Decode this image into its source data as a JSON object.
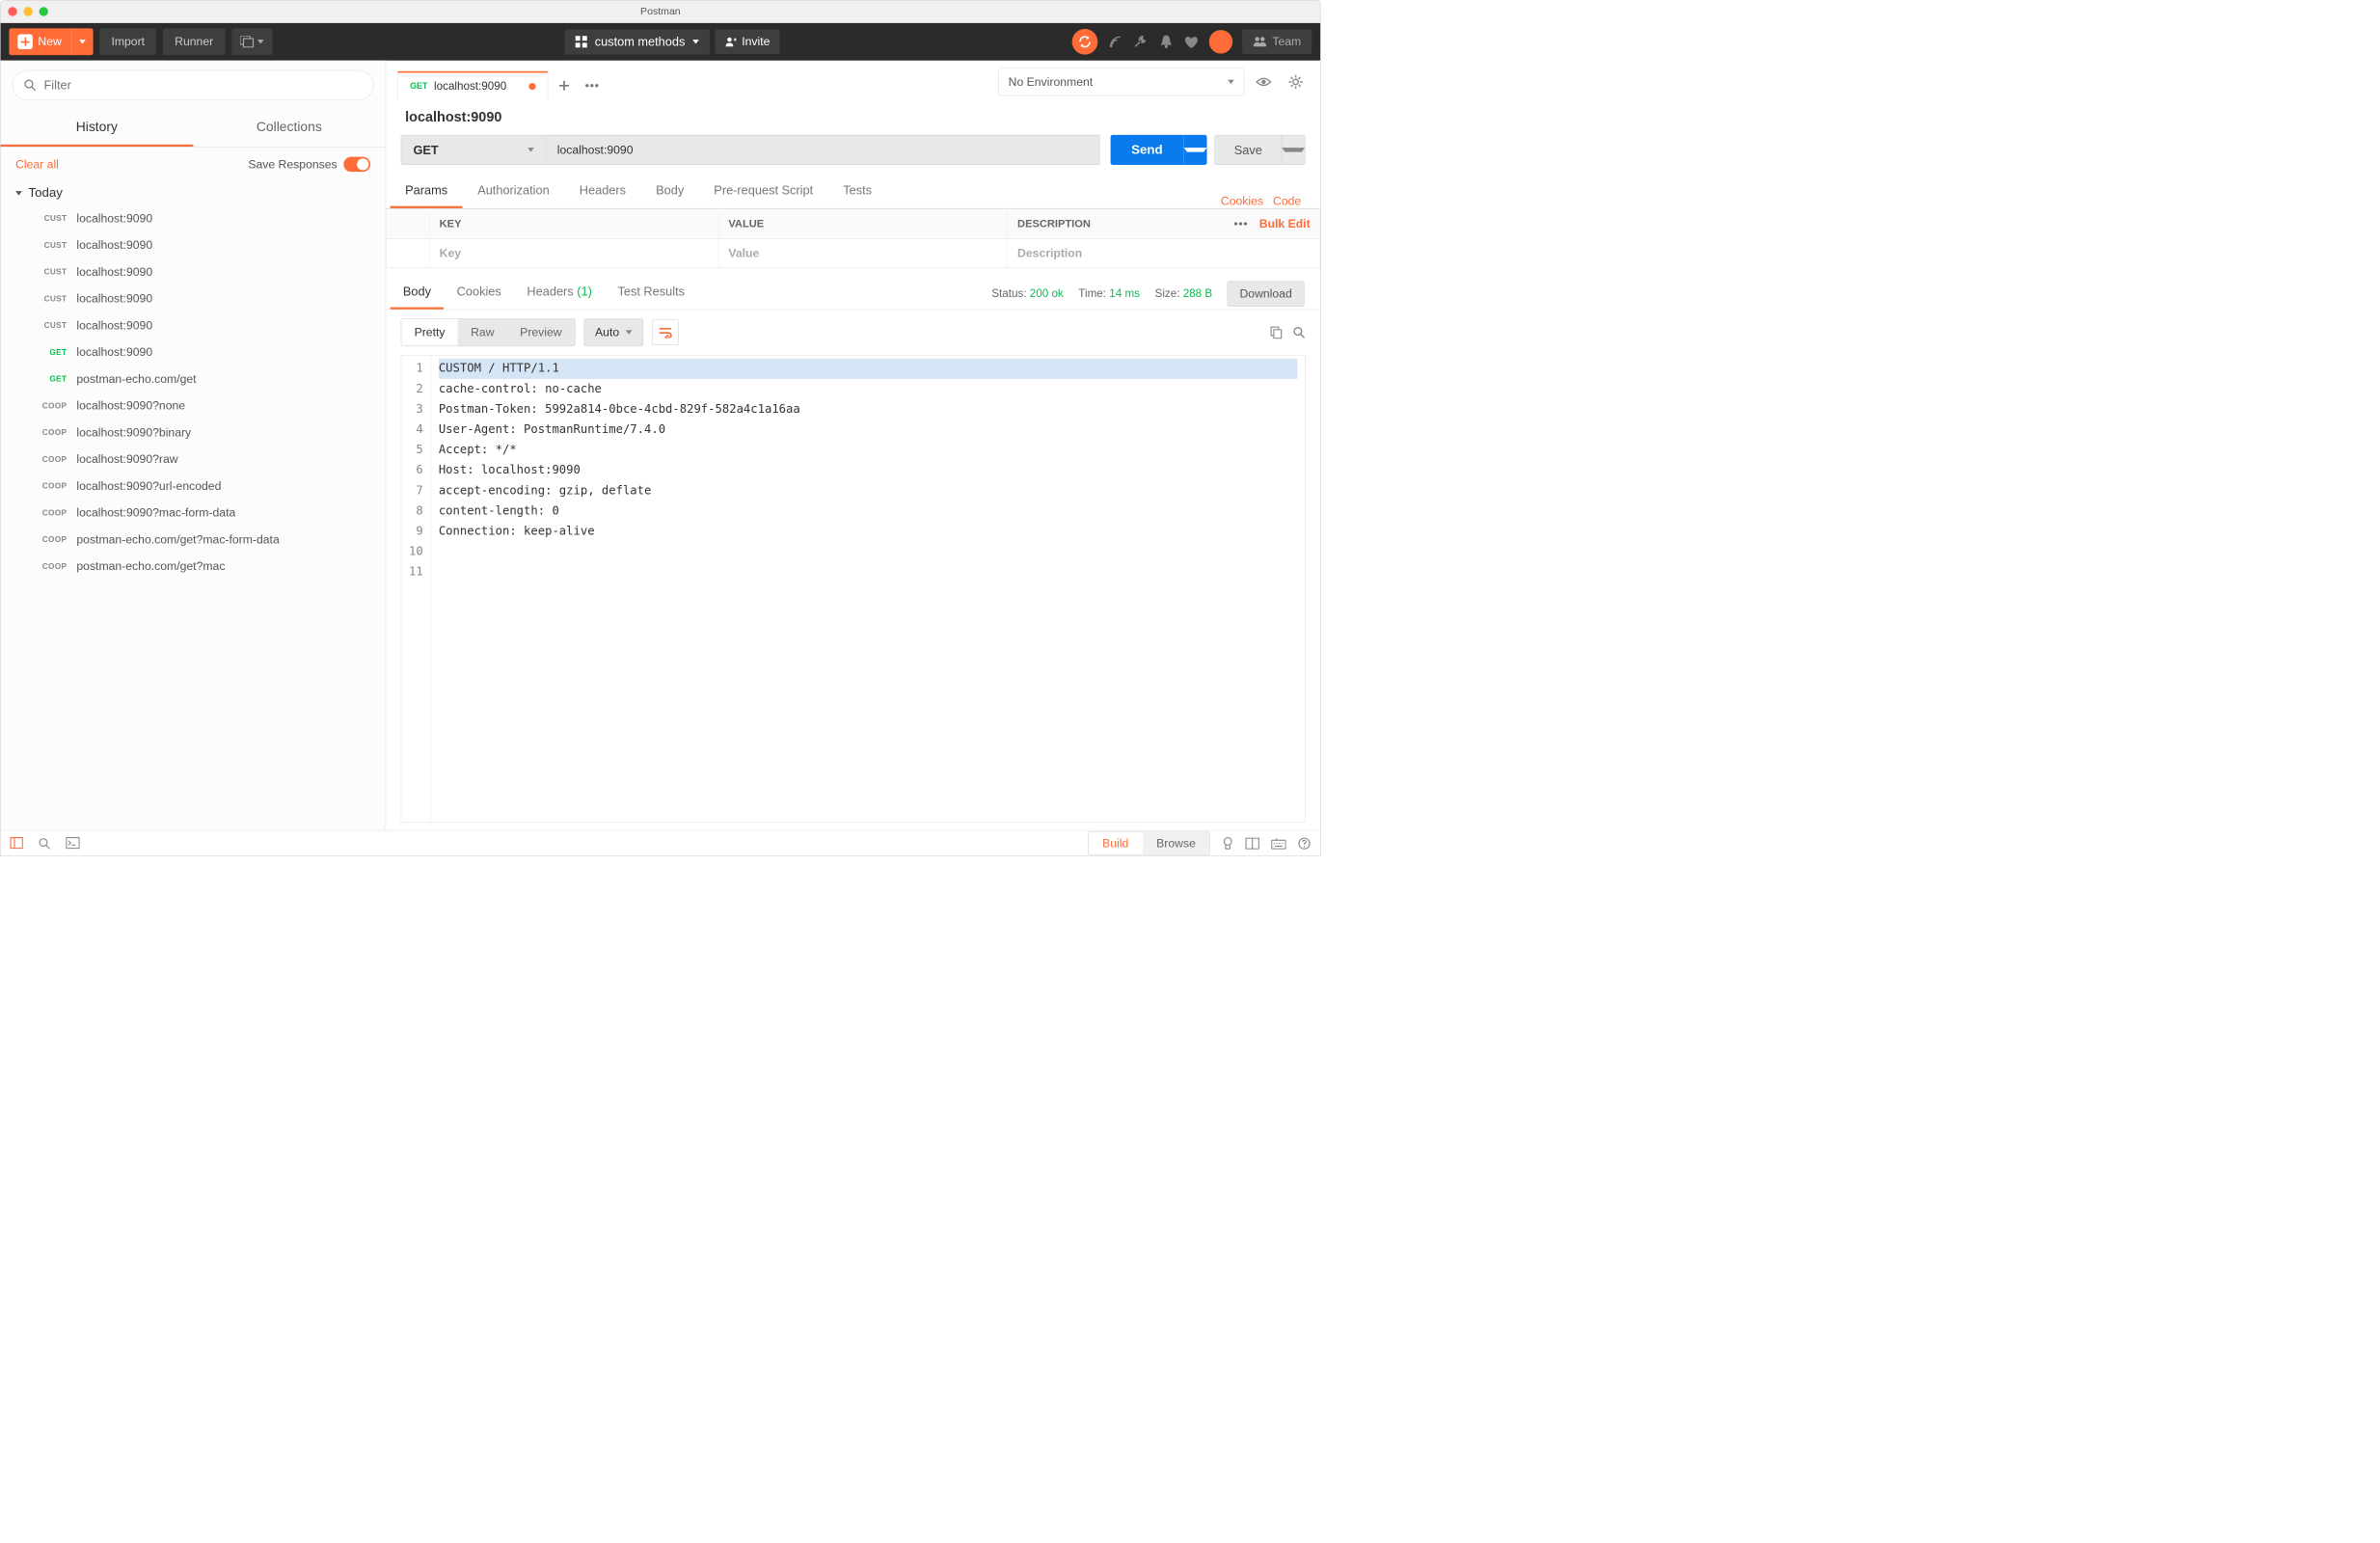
{
  "window": {
    "title": "Postman"
  },
  "toolbar": {
    "new_label": "New",
    "import_label": "Import",
    "runner_label": "Runner",
    "workspace_label": "custom methods",
    "invite_label": "Invite",
    "team_label": "Team"
  },
  "sidebar": {
    "filter_placeholder": "Filter",
    "tabs": {
      "history": "History",
      "collections": "Collections"
    },
    "clear_all": "Clear all",
    "save_responses": "Save Responses",
    "group_label": "Today",
    "items": [
      {
        "method": "CUST",
        "method_class": "m-cust",
        "url": "localhost:9090"
      },
      {
        "method": "CUST",
        "method_class": "m-cust",
        "url": "localhost:9090"
      },
      {
        "method": "CUST",
        "method_class": "m-cust",
        "url": "localhost:9090"
      },
      {
        "method": "CUST",
        "method_class": "m-cust",
        "url": "localhost:9090"
      },
      {
        "method": "CUST",
        "method_class": "m-cust",
        "url": "localhost:9090"
      },
      {
        "method": "GET",
        "method_class": "m-get",
        "url": "localhost:9090"
      },
      {
        "method": "GET",
        "method_class": "m-get",
        "url": "postman-echo.com/get"
      },
      {
        "method": "COOP",
        "method_class": "m-coop",
        "url": "localhost:9090?none"
      },
      {
        "method": "COOP",
        "method_class": "m-coop",
        "url": "localhost:9090?binary"
      },
      {
        "method": "COOP",
        "method_class": "m-coop",
        "url": "localhost:9090?raw"
      },
      {
        "method": "COOP",
        "method_class": "m-coop",
        "url": "localhost:9090?url-encoded"
      },
      {
        "method": "COOP",
        "method_class": "m-coop",
        "url": "localhost:9090?mac-form-data"
      },
      {
        "method": "COOP",
        "method_class": "m-coop",
        "url": "postman-echo.com/get?mac-form-data"
      },
      {
        "method": "COOP",
        "method_class": "m-coop",
        "url": "postman-echo.com/get?mac"
      }
    ]
  },
  "env": {
    "selected": "No Environment"
  },
  "request": {
    "tab_method": "GET",
    "tab_label": "localhost:9090",
    "name": "localhost:9090",
    "method": "GET",
    "url": "localhost:9090",
    "send_label": "Send",
    "save_label": "Save",
    "subtabs": {
      "params": "Params",
      "authorization": "Authorization",
      "headers": "Headers",
      "body": "Body",
      "prerequest": "Pre-request Script",
      "tests": "Tests"
    },
    "cookies_link": "Cookies",
    "code_link": "Code",
    "params_table": {
      "key_header": "KEY",
      "value_header": "VALUE",
      "desc_header": "DESCRIPTION",
      "bulk_edit": "Bulk Edit",
      "key_placeholder": "Key",
      "value_placeholder": "Value",
      "desc_placeholder": "Description"
    }
  },
  "response": {
    "tabs": {
      "body": "Body",
      "cookies": "Cookies",
      "headers": "Headers",
      "headers_count": "(1)",
      "test_results": "Test Results"
    },
    "status_label": "Status:",
    "status_value": "200 ok",
    "time_label": "Time:",
    "time_value": "14 ms",
    "size_label": "Size:",
    "size_value": "288 B",
    "download_label": "Download",
    "view": {
      "pretty": "Pretty",
      "raw": "Raw",
      "preview": "Preview",
      "format": "Auto"
    },
    "body_lines": [
      "CUSTOM / HTTP/1.1",
      "cache-control: no-cache",
      "Postman-Token: 5992a814-0bce-4cbd-829f-582a4c1a16aa",
      "User-Agent: PostmanRuntime/7.4.0",
      "Accept: */*",
      "Host: localhost:9090",
      "accept-encoding: gzip, deflate",
      "content-length: 0",
      "Connection: keep-alive",
      "",
      ""
    ]
  },
  "statusbar": {
    "build": "Build",
    "browse": "Browse"
  }
}
